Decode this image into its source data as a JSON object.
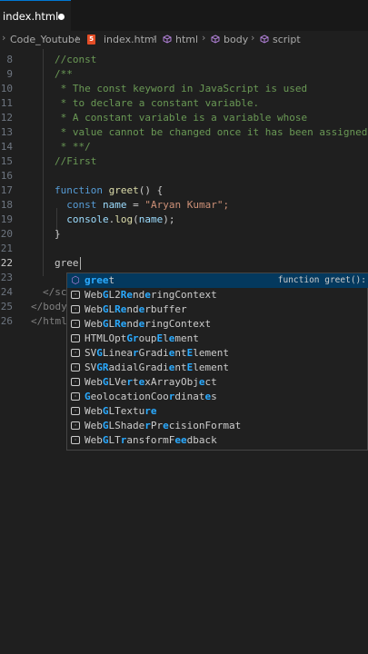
{
  "tab": {
    "label": "index.html"
  },
  "breadcrumb": [
    "Code_Youtube",
    "index.html",
    "html",
    "body",
    "script"
  ],
  "editor": {
    "lines": [
      {
        "num": "8",
        "text": "//const"
      },
      {
        "num": "9",
        "text": "/**"
      },
      {
        "num": "10",
        "text": " * The const keyword in JavaScript is used"
      },
      {
        "num": "11",
        "text": " * to declare a constant variable."
      },
      {
        "num": "12",
        "text": " * A constant variable is a variable whose"
      },
      {
        "num": "13",
        "text": " * value cannot be changed once it has been assigned."
      },
      {
        "num": "14",
        "text": " * **/"
      },
      {
        "num": "15",
        "text": "//First"
      },
      {
        "num": "16",
        "text": ""
      },
      {
        "num": "17",
        "text": "function greet() {"
      },
      {
        "num": "18",
        "text": "  const name = \"Aryan Kumar\";"
      },
      {
        "num": "19",
        "text": "  console.log(name);"
      },
      {
        "num": "20",
        "text": "}"
      },
      {
        "num": "21",
        "text": ""
      },
      {
        "num": "22",
        "text": "gree"
      },
      {
        "num": "23",
        "text": ""
      },
      {
        "num": "24",
        "text": "</sc"
      },
      {
        "num": "25",
        "text": "</body"
      },
      {
        "num": "26",
        "text": "</html"
      }
    ],
    "active_line": "22"
  },
  "suggestions": [
    {
      "label": "greet",
      "match": "greet",
      "detail": "function greet():",
      "icon": "function-cube-icon",
      "selected": true
    },
    {
      "label": "WebGL2RenderingContext",
      "icon": "variable-icon"
    },
    {
      "label": "WebGLRenderbuffer",
      "icon": "variable-icon"
    },
    {
      "label": "WebGLRenderingContext",
      "icon": "variable-icon"
    },
    {
      "label": "HTMLOptGroupElement",
      "icon": "variable-icon"
    },
    {
      "label": "SVGLinearGradientElement",
      "icon": "variable-icon"
    },
    {
      "label": "SVGRadialGradientElement",
      "icon": "variable-icon"
    },
    {
      "label": "WebGLVertexArrayObject",
      "icon": "variable-icon"
    },
    {
      "label": "GeolocationCoordinates",
      "icon": "variable-icon"
    },
    {
      "label": "WebGLTexture",
      "icon": "variable-icon"
    },
    {
      "label": "WebGLShaderPrecisionFormat",
      "icon": "variable-icon"
    },
    {
      "label": "WebGLTransformFeedback",
      "icon": "variable-icon"
    }
  ],
  "colors": {
    "accent": "#0078d4",
    "comment": "#6a9955",
    "keyword": "#569cd6",
    "function": "#dcdcaa",
    "string": "#ce9178",
    "match": "#2aaaff"
  }
}
